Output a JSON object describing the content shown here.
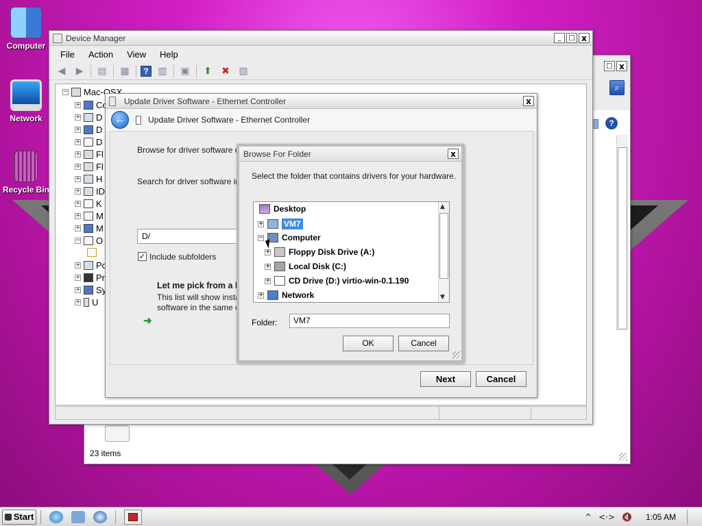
{
  "desktop": {
    "icons": [
      {
        "label": "Computer"
      },
      {
        "label": "Network"
      },
      {
        "label": "Recycle Bin"
      }
    ]
  },
  "explorer": {
    "status": "23 items",
    "title_controls": [
      "_",
      "□",
      "x"
    ]
  },
  "device_manager": {
    "title": "Device Manager",
    "menu": [
      "File",
      "Action",
      "View",
      "Help"
    ],
    "tree_root": "Mac-OSX",
    "tree_items": [
      "Co",
      "D",
      "D",
      "D",
      "Fl",
      "Fl",
      "H",
      "ID",
      "K",
      "M",
      "M",
      "O",
      "",
      "Po",
      "Pr",
      "Sy",
      "U"
    ]
  },
  "update_driver": {
    "title": "Update Driver Software - Ethernet Controller",
    "heading": "Update Driver Software - Ethernet Controller",
    "browse_text": "Browse for driver software o",
    "search_text": "Search for driver software in",
    "path_value": "D/",
    "include_subfolders": "Include subfolders",
    "pick_title": "Let me pick from a lis",
    "pick_desc_1": "This list will show insta",
    "pick_desc_2": "software in the same c",
    "next_label": "Next",
    "cancel_label": "Cancel"
  },
  "browse_folder": {
    "title": "Browse For Folder",
    "description": "Select the folder that contains drivers for your hardware.",
    "tree": {
      "desktop": "Desktop",
      "vm7": "VM7",
      "computer": "Computer",
      "floppy": "Floppy Disk Drive (A:)",
      "local_disk": "Local Disk (C:)",
      "cd_drive": "CD Drive (D:) virtio-win-0.1.190",
      "network": "Network"
    },
    "folder_label": "Folder:",
    "folder_value": "VM7",
    "ok_label": "OK",
    "cancel_label": "Cancel"
  },
  "taskbar": {
    "start_label": "Start",
    "clock": "1:05 AM"
  },
  "colors": {
    "desktop_bg": "#c41ab4",
    "selection": "#3c8ce6"
  }
}
